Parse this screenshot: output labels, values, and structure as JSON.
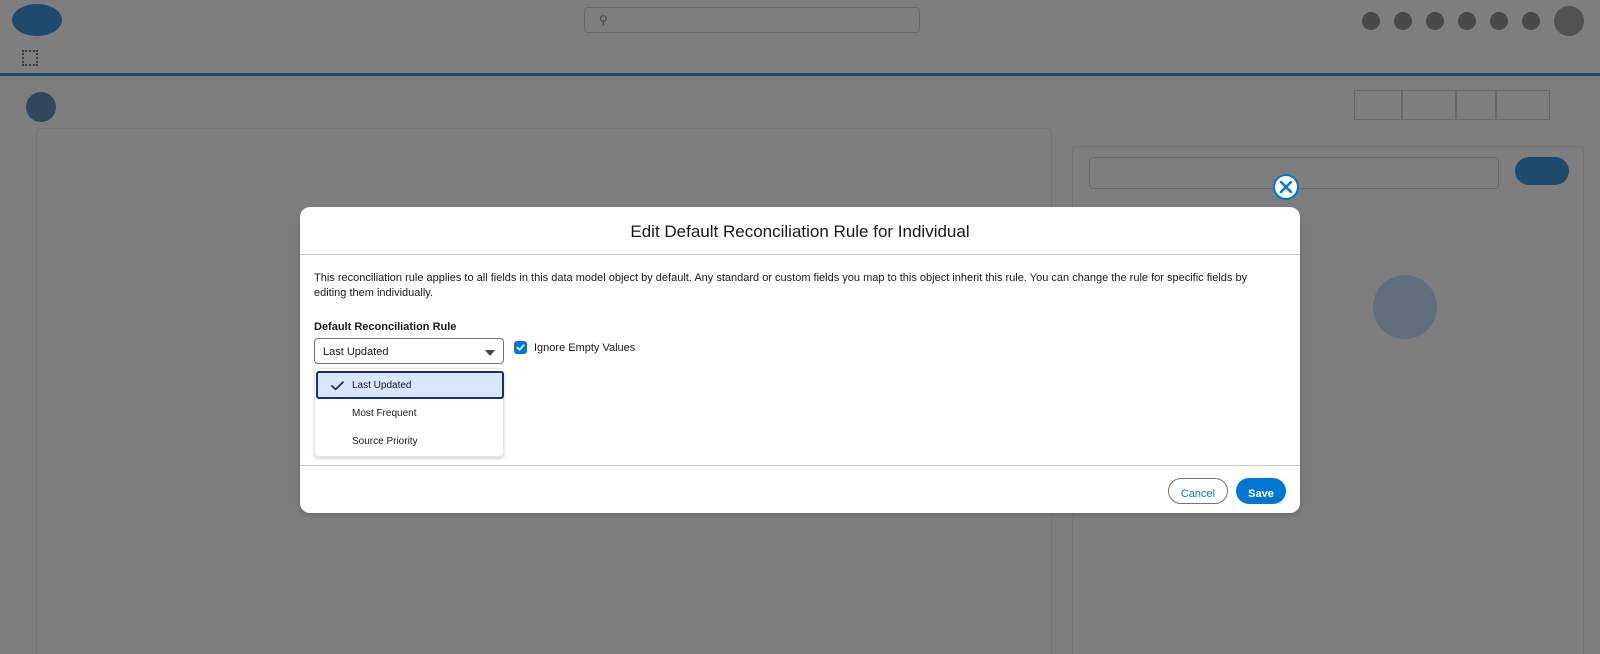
{
  "modal": {
    "title": "Edit Default Reconciliation Rule for Individual",
    "description": "This reconciliation rule applies to all fields in this data model object by default. Any standard or custom fields you map to this object inherit this rule. You can change the rule for specific fields by editing them individually.",
    "field_label": "Default Reconciliation Rule",
    "selected_value": "Last Updated",
    "options": [
      {
        "label": "Last Updated",
        "selected": true
      },
      {
        "label": "Most Frequent",
        "selected": false
      },
      {
        "label": "Source Priority",
        "selected": false
      }
    ],
    "checkbox_label": "Ignore Empty Values",
    "checkbox_checked": true,
    "cancel_label": "Cancel",
    "save_label": "Save"
  },
  "colors": {
    "brand": "#0176d3",
    "selected_option_bg": "#d8e6fe",
    "selected_option_border": "#1b2f6b",
    "backdrop": "#2e2e2e"
  },
  "icons": {
    "close": "close-icon",
    "check": "check-icon",
    "caret": "chevron-down-icon",
    "checkbox": "checkbox-checked-icon"
  }
}
